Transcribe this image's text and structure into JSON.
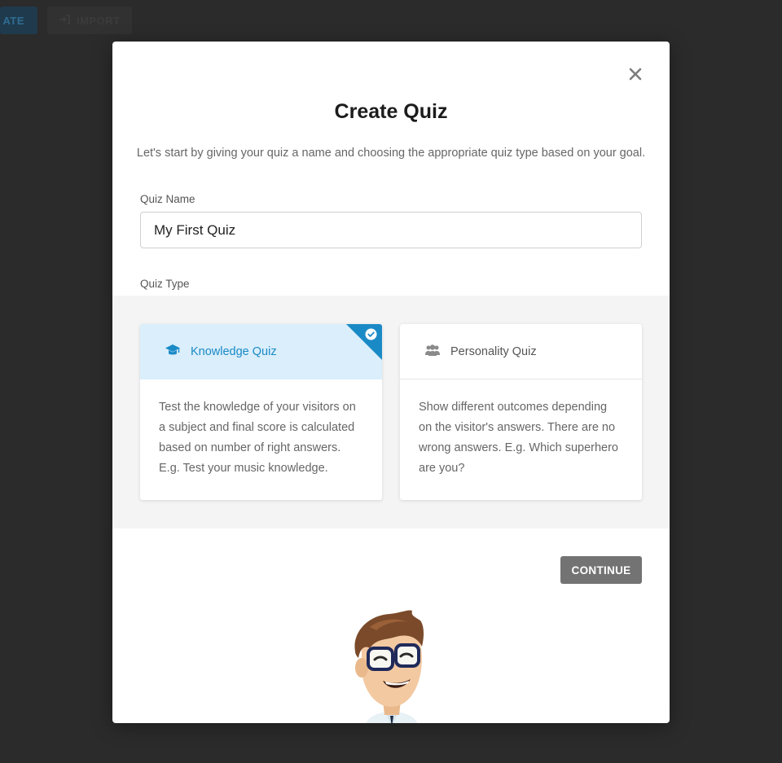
{
  "background": {
    "create_label": "ATE",
    "import_label": "IMPORT"
  },
  "modal": {
    "title": "Create Quiz",
    "subtitle": "Let's start by giving your quiz a name and choosing the appropriate quiz type based on your goal.",
    "name_label": "Quiz Name",
    "name_value": "My First Quiz",
    "type_label": "Quiz Type",
    "types": [
      {
        "label": "Knowledge Quiz",
        "icon": "graduation-cap-icon",
        "selected": true,
        "description": "Test the knowledge of your visitors on a subject and final score is calculated based on number of right answers. E.g. Test your music knowledge."
      },
      {
        "label": "Personality Quiz",
        "icon": "users-icon",
        "selected": false,
        "description": "Show different outcomes depending on the visitor's answers. There are no wrong answers. E.g. Which superhero are you?"
      }
    ],
    "continue_label": "CONTINUE"
  },
  "colors": {
    "accent": "#1a8ac6",
    "selected_bg": "#daeefb",
    "button_bg": "#737373",
    "overlay": "#2b2b2b"
  }
}
